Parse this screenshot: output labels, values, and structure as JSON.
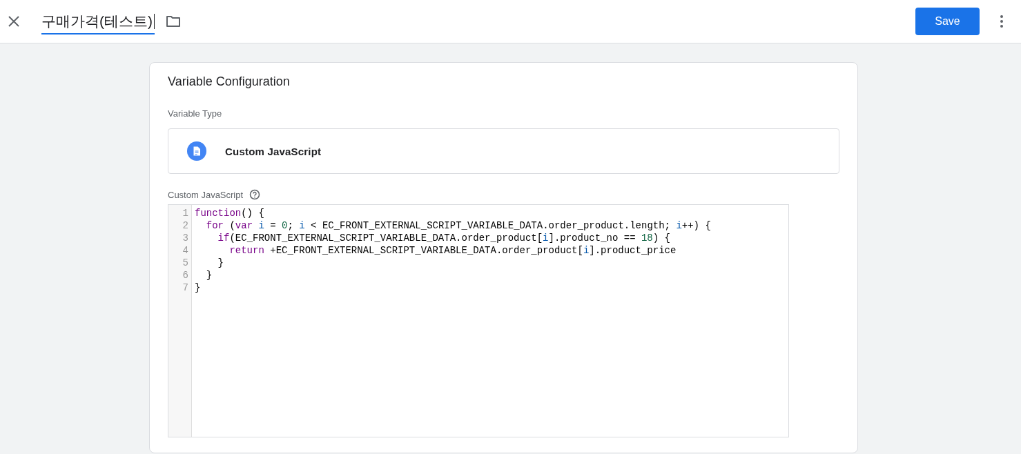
{
  "header": {
    "title": "구매가격(테스트)",
    "save_label": "Save"
  },
  "card": {
    "title": "Variable Configuration",
    "type_label": "Variable Type",
    "type_name": "Custom JavaScript",
    "code_label": "Custom JavaScript"
  },
  "code": {
    "lines": [
      {
        "number": "1",
        "tokens": [
          {
            "kind": "keyword",
            "text": "function"
          },
          {
            "kind": "plain",
            "text": "() {"
          }
        ]
      },
      {
        "number": "2",
        "tokens": [
          {
            "kind": "keyword",
            "text": "  for"
          },
          {
            "kind": "plain",
            "text": " ("
          },
          {
            "kind": "keyword",
            "text": "var"
          },
          {
            "kind": "variable",
            "text": " i"
          },
          {
            "kind": "plain",
            "text": " = "
          },
          {
            "kind": "number",
            "text": "0"
          },
          {
            "kind": "plain",
            "text": "; "
          },
          {
            "kind": "variable",
            "text": "i"
          },
          {
            "kind": "plain",
            "text": " < EC_FRONT_EXTERNAL_SCRIPT_VARIABLE_DATA.order_product.length; "
          },
          {
            "kind": "variable",
            "text": "i"
          },
          {
            "kind": "plain",
            "text": "++) {"
          }
        ]
      },
      {
        "number": "3",
        "tokens": [
          {
            "kind": "keyword",
            "text": "    if"
          },
          {
            "kind": "plain",
            "text": "(EC_FRONT_EXTERNAL_SCRIPT_VARIABLE_DATA.order_product["
          },
          {
            "kind": "variable",
            "text": "i"
          },
          {
            "kind": "plain",
            "text": "].product_no == "
          },
          {
            "kind": "number",
            "text": "18"
          },
          {
            "kind": "plain",
            "text": ") {"
          }
        ]
      },
      {
        "number": "4",
        "tokens": [
          {
            "kind": "keyword",
            "text": "      return"
          },
          {
            "kind": "plain",
            "text": " +EC_FRONT_EXTERNAL_SCRIPT_VARIABLE_DATA.order_product["
          },
          {
            "kind": "variable",
            "text": "i"
          },
          {
            "kind": "plain",
            "text": "].product_price"
          }
        ]
      },
      {
        "number": "5",
        "tokens": [
          {
            "kind": "plain",
            "text": "    }"
          }
        ]
      },
      {
        "number": "6",
        "tokens": [
          {
            "kind": "plain",
            "text": "  }"
          }
        ]
      },
      {
        "number": "7",
        "tokens": [
          {
            "kind": "plain",
            "text": "}"
          }
        ]
      }
    ]
  }
}
